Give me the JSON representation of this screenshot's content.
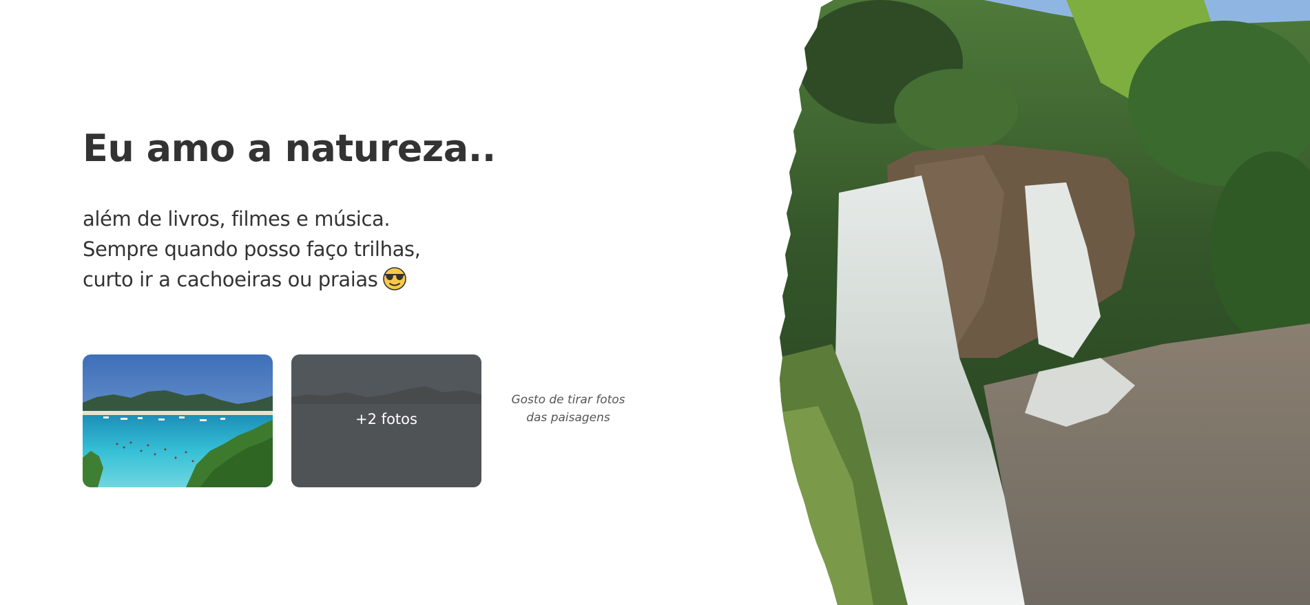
{
  "hero": {
    "title": "Eu amo a natureza..",
    "description_lines": [
      "além de livros, filmes e música.",
      "Sempre quando posso faço trilhas,",
      "curto ir a cachoeiras ou praias"
    ],
    "emoji": "smiling-face-with-sunglasses-icon"
  },
  "gallery": {
    "photos": [
      {
        "name": "beach-photo"
      },
      {
        "name": "more-photos",
        "overlay_label": "+2 fotos"
      }
    ],
    "caption_lines": [
      "Gosto de tirar fotos",
      "das paisagens"
    ]
  },
  "colors": {
    "text": "#333333",
    "caption": "#555555",
    "overlay": "#424242",
    "background": "#ffffff"
  },
  "image": {
    "hero_picture": "waterfall-photo"
  }
}
